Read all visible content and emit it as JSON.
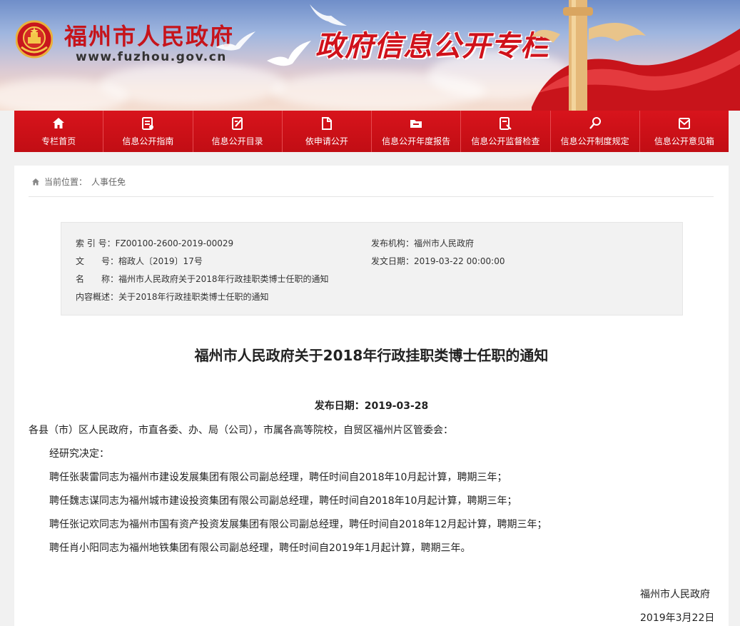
{
  "header": {
    "site_name": "福州市人民政府",
    "site_url": "www.fuzhou.gov.cn",
    "column_title": "政府信息公开专栏"
  },
  "nav": [
    {
      "label": "专栏首页",
      "icon": "home-icon"
    },
    {
      "label": "信息公开指南",
      "icon": "guide-icon"
    },
    {
      "label": "信息公开目录",
      "icon": "catalog-icon"
    },
    {
      "label": "依申请公开",
      "icon": "document-icon"
    },
    {
      "label": "信息公开年度报告",
      "icon": "folder-icon"
    },
    {
      "label": "信息公开监督检查",
      "icon": "inspect-icon"
    },
    {
      "label": "信息公开制度规定",
      "icon": "search-icon"
    },
    {
      "label": "信息公开意见箱",
      "icon": "mailbox-icon"
    }
  ],
  "breadcrumb": {
    "prefix": "当前位置：",
    "current": "人事任免"
  },
  "meta": {
    "index_label": "索 引 号：",
    "index_value": "FZ00100-2600-2019-00029",
    "publisher_label": "发布机构：",
    "publisher_value": "福州市人民政府",
    "docno_label": "文　　号：",
    "docno_value": "榕政人〔2019〕17号",
    "issue_date_label": "发文日期：",
    "issue_date_value": "2019-03-22 00:00:00",
    "name_label": "名　　称：",
    "name_value": "福州市人民政府关于2018年行政挂职类博士任职的通知",
    "summary_label": "内容概述：",
    "summary_value": "关于2018年行政挂职类博士任职的通知"
  },
  "article": {
    "title": "福州市人民政府关于2018年行政挂职类博士任职的通知",
    "publish_date": "发布日期：2019-03-28",
    "salutation": "各县（市）区人民政府，市直各委、办、局（公司），市属各高等院校，自贸区福州片区管委会：",
    "paragraphs": [
      "经研究决定：",
      "聘任张裴雷同志为福州市建设发展集团有限公司副总经理，聘任时间自2018年10月起计算，聘期三年；",
      "聘任魏志谋同志为福州城市建设投资集团有限公司副总经理，聘任时间自2018年10月起计算，聘期三年；",
      "聘任张记欢同志为福州市国有资产投资发展集团有限公司副总经理，聘任时间自2018年12月起计算，聘期三年；",
      "聘任肖小阳同志为福州地铁集团有限公司副总经理，聘任时间自2019年1月起计算，聘期三年。"
    ],
    "signature": "福州市人民政府",
    "sign_date": "2019年3月22日"
  }
}
